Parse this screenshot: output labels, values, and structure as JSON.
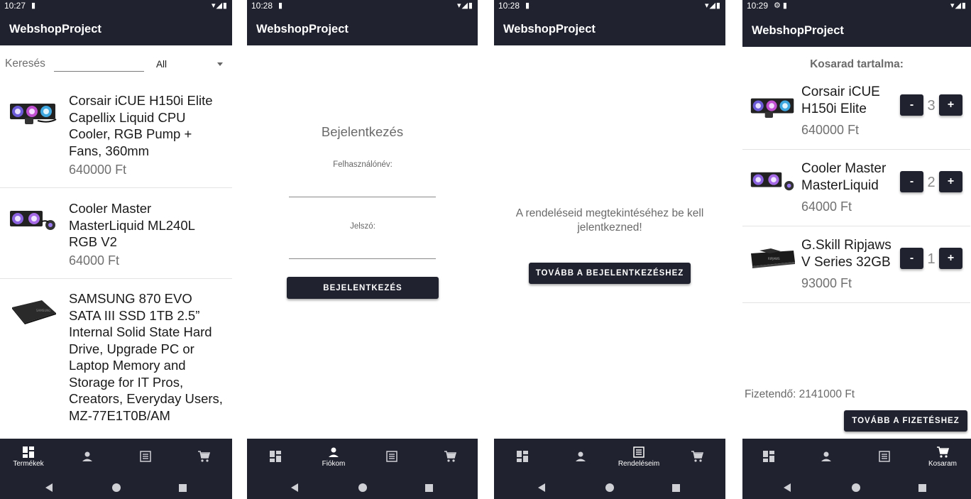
{
  "app_title": "WebshopProject",
  "colors": {
    "bar": "#20222f",
    "text_muted": "#707070",
    "divider": "#e3e3e3"
  },
  "screens": {
    "products": {
      "status_time": "10:27",
      "search_label": "Keresés",
      "search_value": "",
      "filter_selected": "All",
      "items": [
        {
          "name": "Corsair iCUE H150i Elite Capellix Liquid CPU Cooler, RGB Pump + Fans, 360mm",
          "price": "640000 Ft",
          "image": "aio-cooler-3fan"
        },
        {
          "name": "Cooler Master MasterLiquid ML240L RGB V2",
          "price": "64000 Ft",
          "image": "aio-cooler-2fan"
        },
        {
          "name": "SAMSUNG 870 EVO SATA III SSD 1TB 2.5” Internal Solid State Hard Drive, Upgrade PC or Laptop Memory and Storage for IT Pros, Creators, Everyday Users, MZ-77E1T0B/AM",
          "price": "",
          "image": "ssd"
        }
      ],
      "active_tab": "Termékek"
    },
    "login": {
      "status_time": "10:28",
      "heading": "Bejelentkezés",
      "username_label": "Felhasználónév:",
      "username_value": "",
      "password_label": "Jelszó:",
      "password_value": "",
      "login_button": "BEJELENTKEZÉS",
      "active_tab": "Fiókom"
    },
    "orders": {
      "status_time": "10:28",
      "message": "A rendeléseid megtekintéséhez be kell jelentkezned!",
      "button": "TOVÁBB A BEJELENTKEZÉSHEZ",
      "active_tab": "Rendeléseim"
    },
    "cart": {
      "status_time": "10:29",
      "heading": "Kosarad tartalma:",
      "items": [
        {
          "name": "Corsair iCUE H150i Elite",
          "price": "640000 Ft",
          "qty": "3",
          "image": "aio-cooler-3fan"
        },
        {
          "name": "Cooler Master MasterLiquid",
          "price": "64000 Ft",
          "qty": "2",
          "image": "aio-cooler-2fan"
        },
        {
          "name": "G.Skill Ripjaws V Series 32GB",
          "price": "93000 Ft",
          "qty": "1",
          "image": "ram-module"
        }
      ],
      "minus_label": "-",
      "plus_label": "+",
      "total": "Fizetendő: 2141000 Ft",
      "checkout_button": "TOVÁBB A FIZETÉSHEZ",
      "active_tab": "Kosaram"
    }
  },
  "nav_icons": [
    "dashboard-icon",
    "person-icon",
    "list-icon",
    "cart-icon"
  ]
}
